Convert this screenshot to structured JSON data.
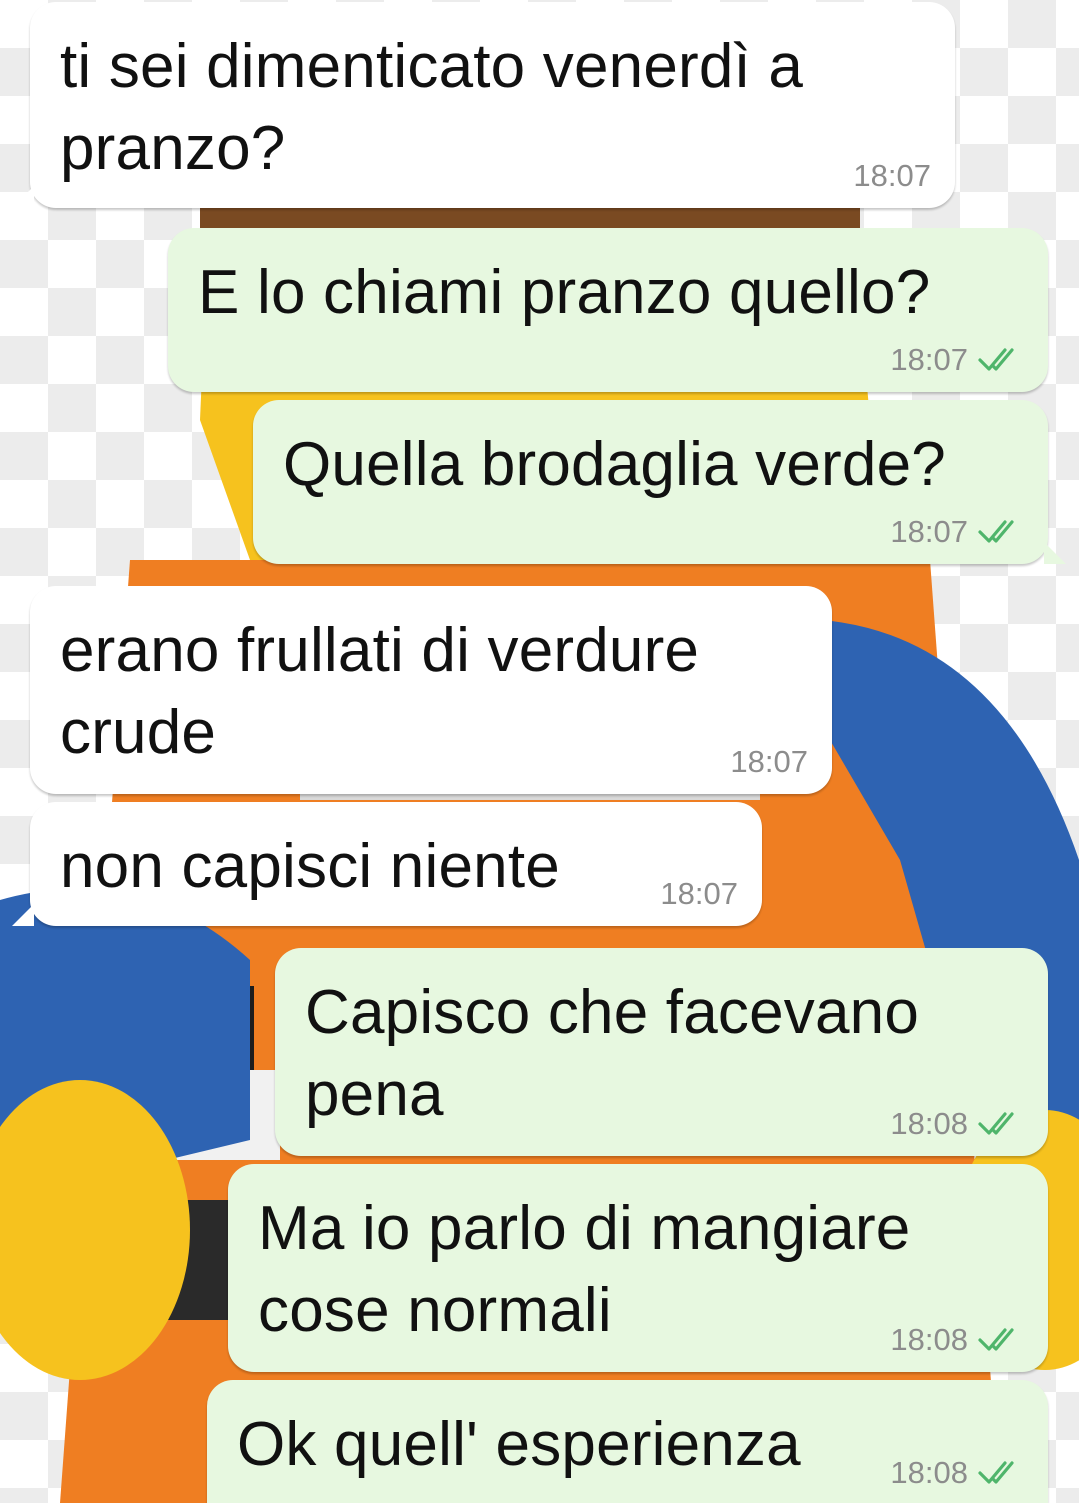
{
  "messages": [
    {
      "direction": "incoming",
      "text": "ti sei dimenticato venerdì a\npranzo?",
      "time": "18:07"
    },
    {
      "direction": "outgoing",
      "text": "E lo chiami pranzo quello?",
      "time": "18:07",
      "status": "read"
    },
    {
      "direction": "outgoing",
      "text": "Quella brodaglia verde?",
      "time": "18:07",
      "status": "read"
    },
    {
      "direction": "incoming",
      "text": "erano frullati di verdure\ncrude",
      "time": "18:07"
    },
    {
      "direction": "incoming",
      "text": "non capisci niente",
      "time": "18:07"
    },
    {
      "direction": "outgoing",
      "text": "Capisco che facevano\npena",
      "time": "18:08",
      "status": "read"
    },
    {
      "direction": "outgoing",
      "text": "Ma io parlo di mangiare\ncose normali",
      "time": "18:08",
      "status": "read"
    },
    {
      "direction": "outgoing",
      "text": "Ok quell' esperienza",
      "time": "18:08",
      "status": "read"
    }
  ],
  "colors": {
    "incoming_bubble": "#ffffff",
    "outgoing_bubble": "#e7f8e0",
    "read_ticks": "#4fb56b",
    "timestamp": "#8c8c8c"
  },
  "icons": {
    "read_status": "double-check-icon",
    "wallpaper": "lego-minifigure-image"
  }
}
